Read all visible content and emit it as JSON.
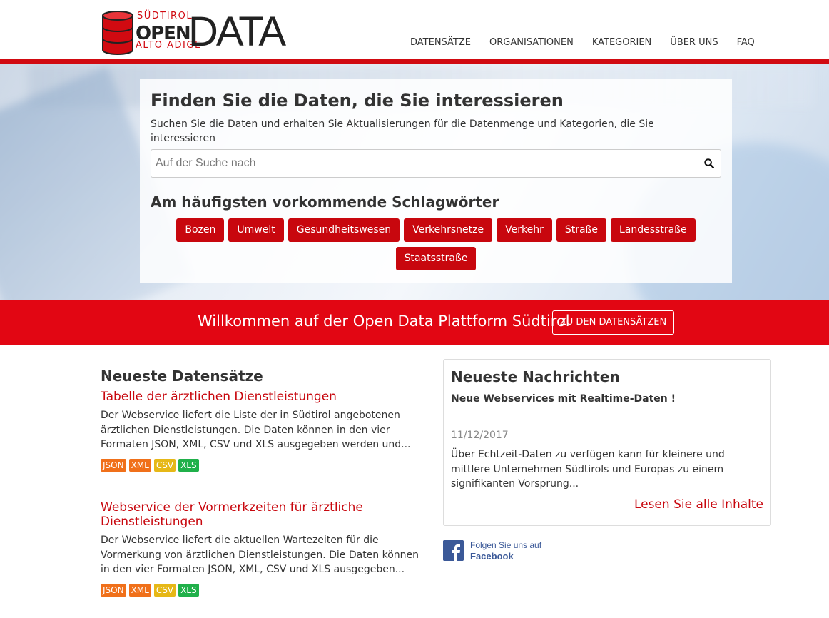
{
  "logo": {
    "top_text": "SÜDTIROL",
    "open_text": "OPEN",
    "bottom_text": "ALTO ADIGE",
    "data_text": "DATA"
  },
  "nav": {
    "items": [
      "DATENSÄTZE",
      "ORGANISATIONEN",
      "KATEGORIEN",
      "ÜBER UNS",
      "FAQ"
    ]
  },
  "hero": {
    "title": "Finden Sie die Daten, die Sie interessieren",
    "subtitle": "Suchen Sie die Daten und erhalten Sie Aktualisierungen für die Datenmenge und Kategorien, die Sie interessieren",
    "search_placeholder": "Auf der Suche nach",
    "tags_title": "Am häufigsten vorkommende Schlagwörter",
    "tags": [
      "Bozen",
      "Umwelt",
      "Gesundheitswesen",
      "Verkehrsnetze",
      "Verkehr",
      "Straße",
      "Landesstraße",
      "Staatsstraße"
    ]
  },
  "welcome": {
    "text": "Willkommen auf der Open Data Plattform Südtirol",
    "button": "ZU DEN DATENSÄTZEN"
  },
  "datasets": {
    "title": "Neueste Datensätze",
    "items": [
      {
        "title": "Tabelle der ärztlichen Dienstleistungen",
        "desc": "Der Webservice liefert die Liste der in Südtirol angebotenen ärztlichen Dienstleistungen. Die Daten können in den vier Formaten JSON, XML, CSV und XLS ausgegeben werden und...",
        "formats": [
          "JSON",
          "XML",
          "CSV",
          "XLS"
        ]
      },
      {
        "title": "Webservice der Vormerkzeiten für ärztliche Dienstleistungen",
        "desc": "Der Webservice liefert die aktuellen Wartezeiten für die Vormerkung von ärztlichen Dienstleistungen. Die Daten können in den vier Formaten JSON, XML, CSV und XLS ausgegeben...",
        "formats": [
          "JSON",
          "XML",
          "CSV",
          "XLS"
        ]
      }
    ]
  },
  "news": {
    "title": "Neueste Nachrichten",
    "headline": "Neue Webservices mit Realtime-Daten !",
    "date": "11/12/2017",
    "body": "Über Echtzeit-Daten zu verfügen kann für kleinere und mittlere Unternehmen Südtirols und Europas zu einem signifikanten Vorsprung...",
    "more": "Lesen Sie alle Inhalte"
  },
  "facebook": {
    "line1": "Folgen Sie uns auf",
    "line2": "Facebook"
  },
  "colors": {
    "brand_red": "#d10a11",
    "tag_red": "#c8070e",
    "welcome_red": "#e20613",
    "JSON": "#f0701a",
    "XML": "#f0701a",
    "CSV": "#e6b817",
    "XLS": "#20b04a",
    "facebook": "#3b5998"
  }
}
